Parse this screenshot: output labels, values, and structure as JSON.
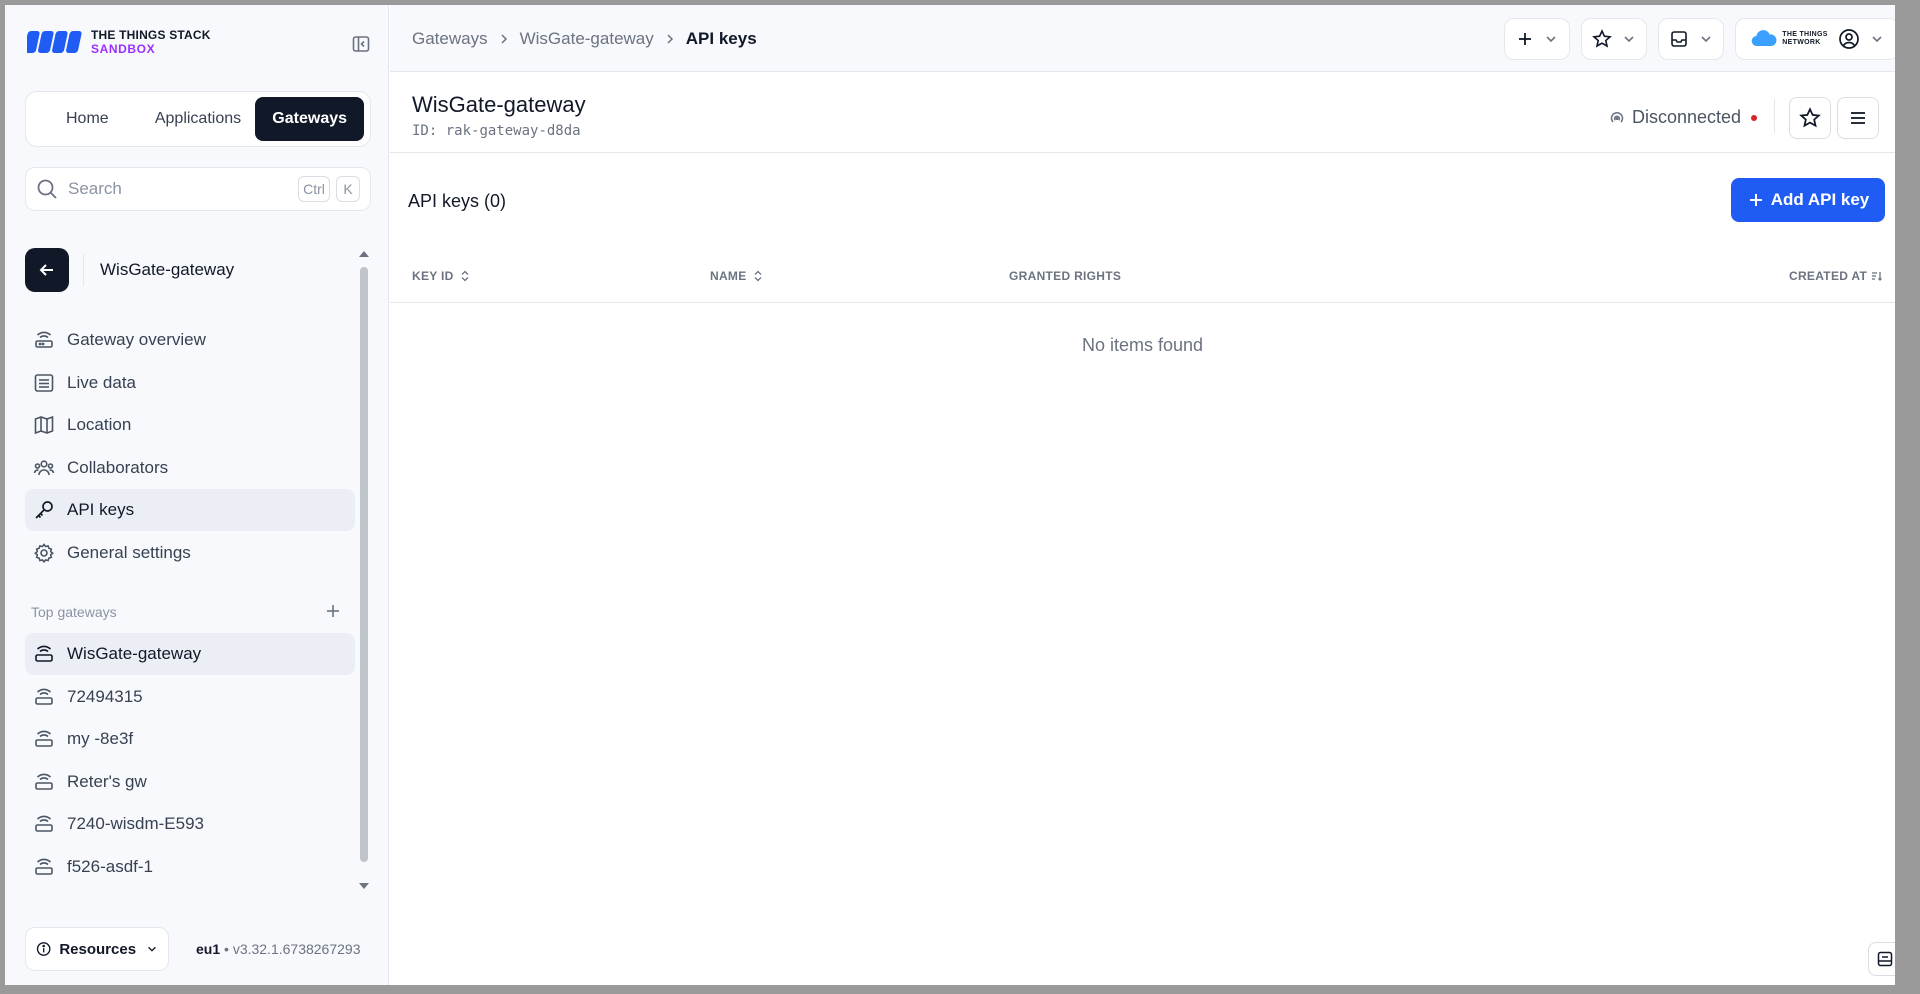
{
  "brand": {
    "line1": "THE THINGS STACK",
    "line2": "SANDBOX"
  },
  "nav": {
    "home": "Home",
    "applications": "Applications",
    "gateways": "Gateways"
  },
  "search": {
    "placeholder": "Search",
    "kbd1": "Ctrl",
    "kbd2": "K"
  },
  "entity": {
    "name": "WisGate-gateway"
  },
  "menu": [
    {
      "label": "Gateway overview",
      "icon": "router-icon"
    },
    {
      "label": "Live data",
      "icon": "list-icon"
    },
    {
      "label": "Location",
      "icon": "map-icon"
    },
    {
      "label": "Collaborators",
      "icon": "users-icon"
    },
    {
      "label": "API keys",
      "icon": "key-icon"
    },
    {
      "label": "General settings",
      "icon": "gear-icon"
    }
  ],
  "top_gateways": {
    "title": "Top gateways",
    "items": [
      "WisGate-gateway",
      "72494315",
      "my -8e3f",
      "Reter's gw",
      "7240-wisdm-E593",
      "f526-asdf-1"
    ]
  },
  "footer": {
    "resources": "Resources",
    "cluster": "eu1",
    "version": "v3.32.1.6738267293"
  },
  "breadcrumbs": [
    "Gateways",
    "WisGate-gateway",
    "API keys"
  ],
  "header": {
    "title": "WisGate-gateway",
    "id_label": "ID:",
    "id_value": "rak-gateway-d8da",
    "status": "Disconnected"
  },
  "table": {
    "title": "API keys (0)",
    "add_button": "Add API key",
    "columns": [
      "KEY ID",
      "NAME",
      "GRANTED RIGHTS",
      "CREATED AT"
    ],
    "empty": "No items found"
  },
  "network_logo": {
    "line1": "THE THINGS",
    "line2": "NETWORK"
  },
  "colors": {
    "accent": "#1f5cf3",
    "dark": "#111827",
    "status_dot": "#dc2626",
    "brand_purple": "#9b30ff"
  }
}
